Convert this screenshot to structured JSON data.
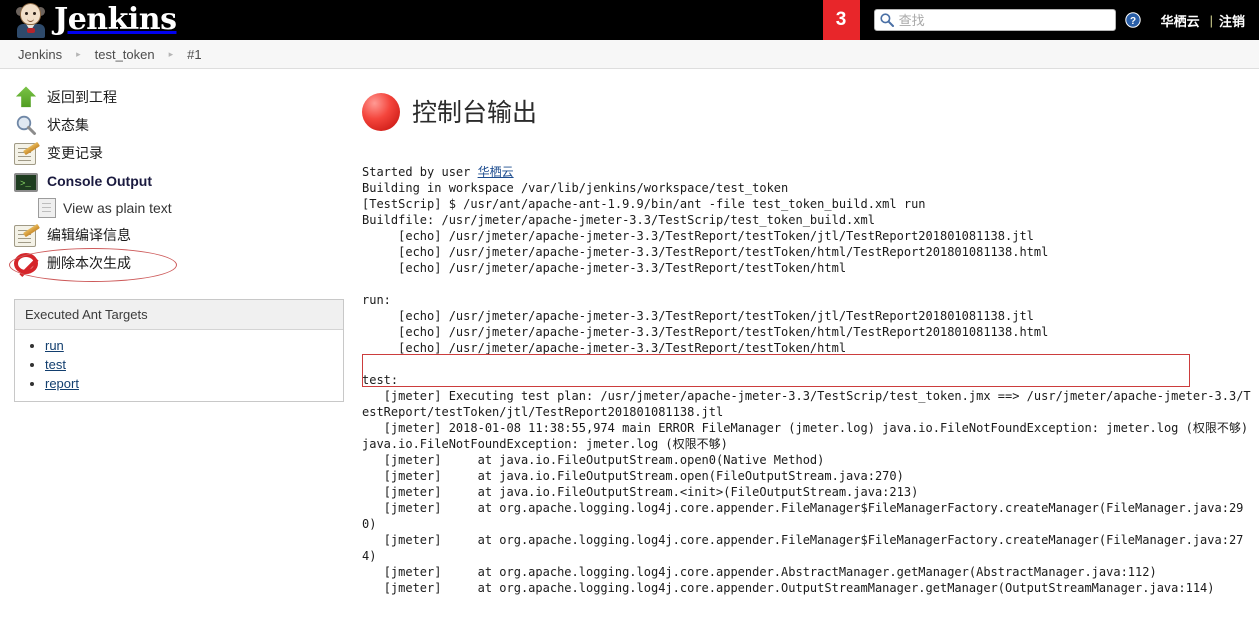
{
  "header": {
    "brand": "Jenkins",
    "build_badge": "3",
    "search_placeholder": "查找",
    "search_value": "",
    "user": "华栖云",
    "separator": "|",
    "logout": "注销",
    "badge_color": "#e8262a",
    "bar_color": "#000000"
  },
  "breadcrumb": {
    "items": [
      "Jenkins",
      "test_token",
      "#1"
    ],
    "separator": "▸"
  },
  "sidebar": {
    "tasks": [
      {
        "label": "返回到工程",
        "icon": "up-arrow-icon"
      },
      {
        "label": "状态集",
        "icon": "magnifier-icon"
      },
      {
        "label": "变更记录",
        "icon": "notepad-pencil-icon"
      },
      {
        "label": "Console Output",
        "icon": "terminal-icon",
        "active": true
      },
      {
        "label": "View as plain text",
        "icon": "document-icon",
        "sub": true
      },
      {
        "label": "编辑编译信息",
        "icon": "notepad-pencil-icon"
      },
      {
        "label": "删除本次生成",
        "icon": "prohibition-icon"
      }
    ],
    "ant_panel": {
      "title": "Executed Ant Targets",
      "targets": [
        "run",
        "test",
        "report"
      ]
    },
    "annotation_color": "#cd5a5a"
  },
  "main": {
    "title": "控制台输出",
    "status_color": "#e03127",
    "error_box_color": "#cc3d3d",
    "console_lines": [
      {
        "text": "Started by user ",
        "link": "华栖云"
      },
      {
        "text": "Building in workspace /var/lib/jenkins/workspace/test_token"
      },
      {
        "text": "[TestScrip] $ /usr/ant/apache-ant-1.9.9/bin/ant -file test_token_build.xml run"
      },
      {
        "text": "Buildfile: /usr/jmeter/apache-jmeter-3.3/TestScrip/test_token_build.xml"
      },
      {
        "text": "     [echo] /usr/jmeter/apache-jmeter-3.3/TestReport/testToken/jtl/TestReport201801081138.jtl"
      },
      {
        "text": "     [echo] /usr/jmeter/apache-jmeter-3.3/TestReport/testToken/html/TestReport201801081138.html"
      },
      {
        "text": "     [echo] /usr/jmeter/apache-jmeter-3.3/TestReport/testToken/html"
      },
      {
        "text": ""
      },
      {
        "text": "run:"
      },
      {
        "text": "     [echo] /usr/jmeter/apache-jmeter-3.3/TestReport/testToken/jtl/TestReport201801081138.jtl"
      },
      {
        "text": "     [echo] /usr/jmeter/apache-jmeter-3.3/TestReport/testToken/html/TestReport201801081138.html"
      },
      {
        "text": "     [echo] /usr/jmeter/apache-jmeter-3.3/TestReport/testToken/html"
      },
      {
        "text": ""
      },
      {
        "text": "test:"
      },
      {
        "text": "   [jmeter] Executing test plan: /usr/jmeter/apache-jmeter-3.3/TestScrip/test_token.jmx ==> /usr/jmeter/apache-jmeter-3.3/TestReport/testToken/jtl/TestReport201801081138.jtl"
      },
      {
        "text": "   [jmeter] 2018-01-08 11:38:55,974 main ERROR FileManager (jmeter.log) java.io.FileNotFoundException: jmeter.log (权限不够) java.io.FileNotFoundException: jmeter.log (权限不够)"
      },
      {
        "text": "   [jmeter] \tat java.io.FileOutputStream.open0(Native Method)"
      },
      {
        "text": "   [jmeter] \tat java.io.FileOutputStream.open(FileOutputStream.java:270)"
      },
      {
        "text": "   [jmeter] \tat java.io.FileOutputStream.<init>(FileOutputStream.java:213)"
      },
      {
        "text": "   [jmeter] \tat org.apache.logging.log4j.core.appender.FileManager$FileManagerFactory.createManager(FileManager.java:290)"
      },
      {
        "text": "   [jmeter] \tat org.apache.logging.log4j.core.appender.FileManager$FileManagerFactory.createManager(FileManager.java:274)"
      },
      {
        "text": "   [jmeter] \tat org.apache.logging.log4j.core.appender.AbstractManager.getManager(AbstractManager.java:112)"
      },
      {
        "text": "   [jmeter] \tat org.apache.logging.log4j.core.appender.OutputStreamManager.getManager(OutputStreamManager.java:114)"
      }
    ]
  }
}
